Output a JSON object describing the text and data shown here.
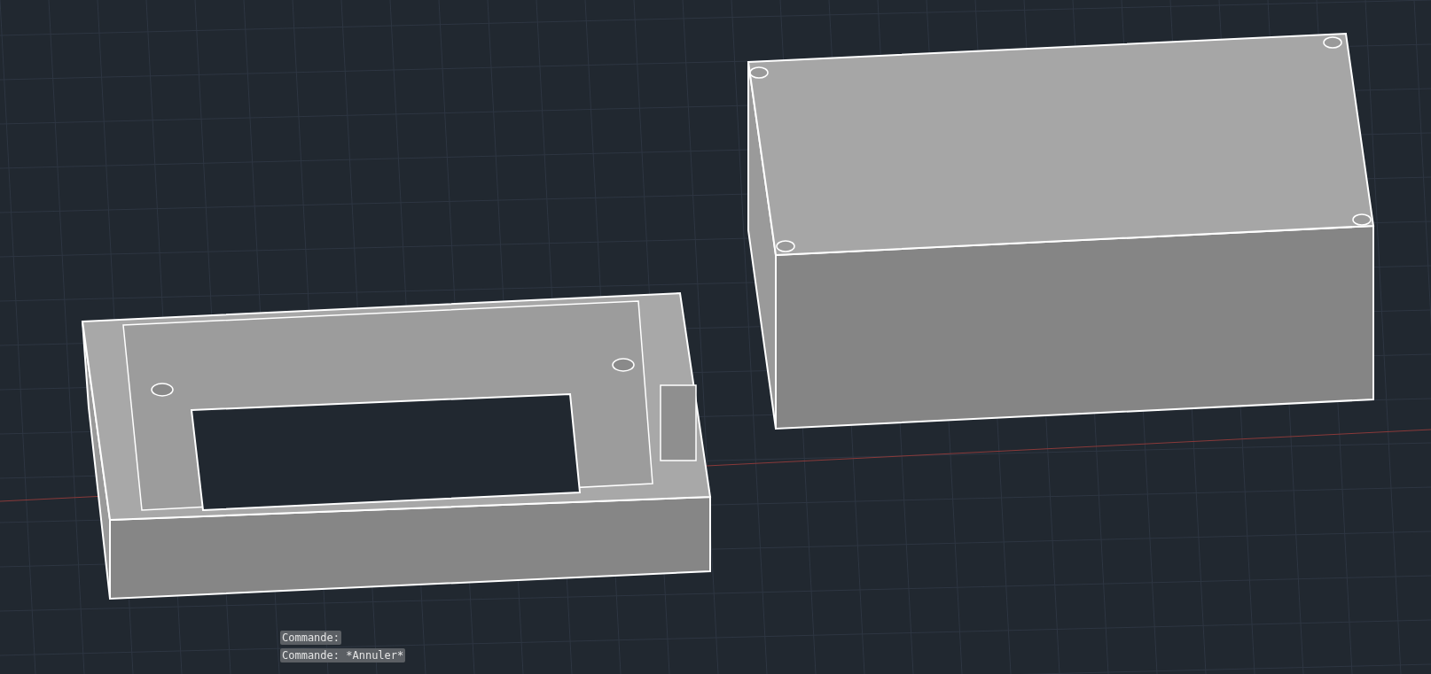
{
  "command_line": {
    "lines": [
      "Commande:",
      "Commande: *Annuler*"
    ]
  }
}
